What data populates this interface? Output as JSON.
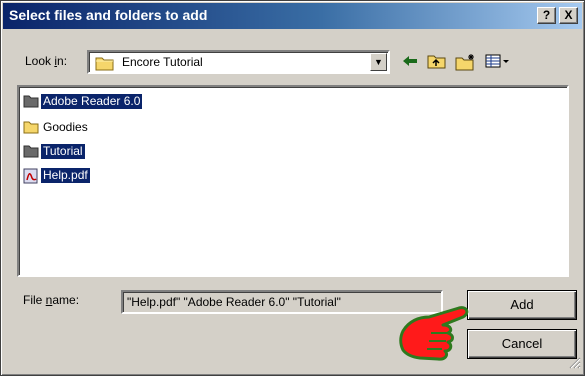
{
  "window": {
    "title": "Select files and folders to add",
    "help_label": "?",
    "close_label": "X"
  },
  "look_in": {
    "label": "Look in:",
    "value": "Encore Tutorial"
  },
  "toolbar": {
    "icons": [
      "back-arrow-icon",
      "up-folder-icon",
      "new-folder-icon",
      "view-menu-icon"
    ]
  },
  "files": [
    {
      "name": "Adobe Reader 6.0",
      "type": "folder",
      "selected": true
    },
    {
      "name": "Goodies",
      "type": "folder",
      "selected": false
    },
    {
      "name": "Tutorial",
      "type": "folder",
      "selected": true
    },
    {
      "name": "Help.pdf",
      "type": "pdf",
      "selected": true
    }
  ],
  "file_name": {
    "label": "File name:",
    "value": "\"Help.pdf\" \"Adobe Reader 6.0\" \"Tutorial\""
  },
  "buttons": {
    "add": "Add",
    "cancel": "Cancel"
  },
  "colors": {
    "selection": "#0a246a",
    "title_start": "#0a246a",
    "title_end": "#a6caf0",
    "pointer_hand": "#ff1a1a"
  }
}
